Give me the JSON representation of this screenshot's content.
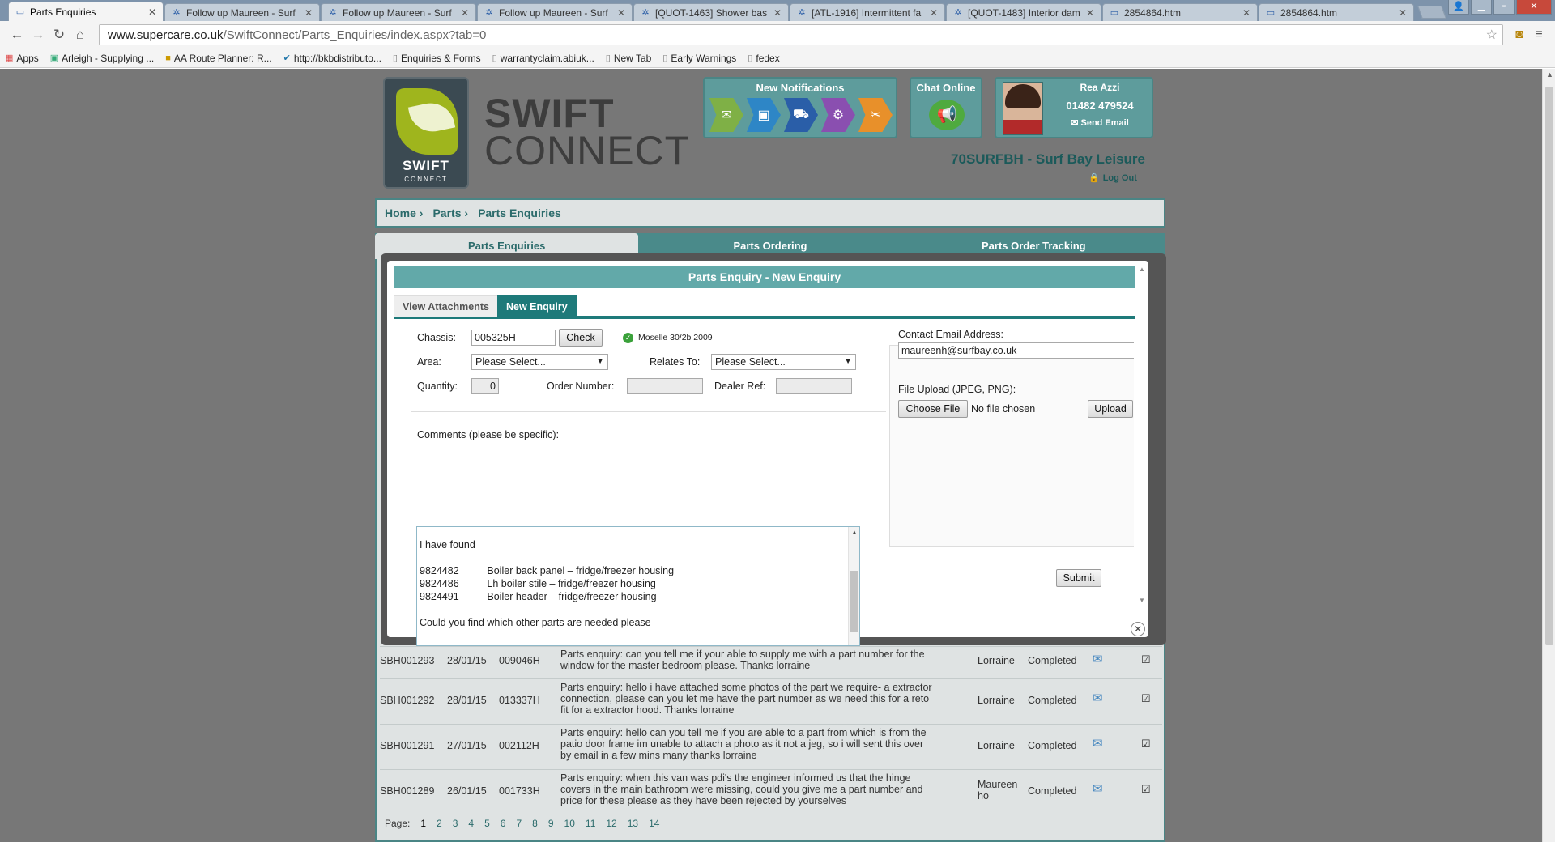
{
  "browser": {
    "tabs": [
      {
        "title": "Parts Enquiries",
        "active": true
      },
      {
        "title": "Follow up Maureen - Surf"
      },
      {
        "title": "Follow up Maureen - Surf"
      },
      {
        "title": "Follow up Maureen - Surf"
      },
      {
        "title": "[QUOT-1463] Shower bas"
      },
      {
        "title": "[ATL-1916] Intermittent fa"
      },
      {
        "title": "[QUOT-1483] Interior dam"
      },
      {
        "title": "2854864.htm"
      },
      {
        "title": "2854864.htm"
      }
    ],
    "url_host": "www.supercare.co.uk",
    "url_path": "/SwiftConnect/Parts_Enquiries/index.aspx?tab=0",
    "bookmarks": [
      "Apps",
      "Arleigh - Supplying ...",
      "AA Route Planner: R...",
      "http://bkbdistributo...",
      "Enquiries & Forms",
      "warrantyclaim.abiuk...",
      "New Tab",
      "Early Warnings",
      "fedex"
    ]
  },
  "header": {
    "logo_badge_text": "SWIFT",
    "logo_badge_sub": "CONNECT",
    "logo_word1": "SWIFT",
    "logo_word2": "CONNECT",
    "notifications_title": "New Notifications",
    "chat_title": "Chat Online",
    "user_name": "Rea Azzi",
    "user_phone": "01482 479524",
    "send_email": "Send Email",
    "dealer": "70SURFBH - Surf Bay Leisure",
    "logout": "Log Out"
  },
  "breadcrumb": [
    "Home",
    "Parts",
    "Parts Enquiries"
  ],
  "main_tabs": [
    "Parts Enquiries",
    "Parts Ordering",
    "Parts Order Tracking"
  ],
  "modal": {
    "title": "Parts Enquiry - New Enquiry",
    "tabs": [
      "View Attachments",
      "New Enquiry"
    ],
    "chassis_label": "Chassis:",
    "chassis_value": "005325H",
    "check_label": "Check",
    "model_text": "Moselle 30/2b 2009",
    "area_label": "Area:",
    "area_value": "Please Select...",
    "relates_label": "Relates To:",
    "relates_value": "Please Select...",
    "quantity_label": "Quantity:",
    "quantity_value": "0",
    "order_label": "Order Number:",
    "order_value": "",
    "dealer_ref_label": "Dealer Ref:",
    "dealer_ref_value": "",
    "comments_label": "Comments (please be specific):",
    "comments_lines": [
      "I have found",
      "",
      "9824482          Boiler back panel – fridge/freezer housing",
      "9824486          Lh boiler stile – fridge/freezer housing",
      "9824491          Boiler header – fridge/freezer housing",
      "",
      "Could you find which other parts are needed please"
    ],
    "email_label": "Contact Email Address:",
    "email_value": "maureenh@surfbay.co.uk",
    "upload_label": "File Upload (JPEG, PNG):",
    "choose_file": "Choose File",
    "no_file": "No file chosen",
    "upload_btn": "Upload",
    "submit_btn": "Submit"
  },
  "table": {
    "rows": [
      {
        "ref": "SBH001293",
        "date": "28/01/15",
        "chassis": "009046H",
        "desc": [
          "Parts enquiry: can you tell me if your able to supply me with a part number for the",
          "window for the master bedroom please. Thanks lorraine"
        ],
        "user": [
          "Lorraine"
        ],
        "status": "Completed"
      },
      {
        "ref": "SBH001292",
        "date": "28/01/15",
        "chassis": "013337H",
        "desc": [
          "Parts enquiry: hello i have attached some photos of the part we require- a extractor",
          "connection, please can you let me have the part number as we need this for a reto",
          "fit for a extractor hood. Thanks lorraine"
        ],
        "user": [
          "Lorraine"
        ],
        "status": "Completed"
      },
      {
        "ref": "SBH001291",
        "date": "27/01/15",
        "chassis": "002112H",
        "desc": [
          "Parts enquiry: hello can you tell me if you are able to a part from which is from the",
          "patio door frame im unable to attach a photo as it not a jeg, so i will sent this over",
          "by email in a few mins many thanks lorraine"
        ],
        "user": [
          "Lorraine"
        ],
        "status": "Completed"
      },
      {
        "ref": "SBH001289",
        "date": "26/01/15",
        "chassis": "001733H",
        "desc": [
          "Parts enquiry: when this van was pdi's the engineer informed us that the hinge",
          "covers in the main bathroom were missing, could you give me a part number and",
          "price for these please as they have been rejected by yourselves"
        ],
        "user": [
          "Maureen",
          "ho"
        ],
        "status": "Completed"
      }
    ],
    "pager_label": "Page:",
    "pages": [
      "1",
      "2",
      "3",
      "4",
      "5",
      "6",
      "7",
      "8",
      "9",
      "10",
      "11",
      "12",
      "13",
      "14"
    ]
  },
  "colors": {
    "teal": "#5e9c9c",
    "dark_teal": "#1e7a7a",
    "header_text": "#1b5a5a"
  }
}
